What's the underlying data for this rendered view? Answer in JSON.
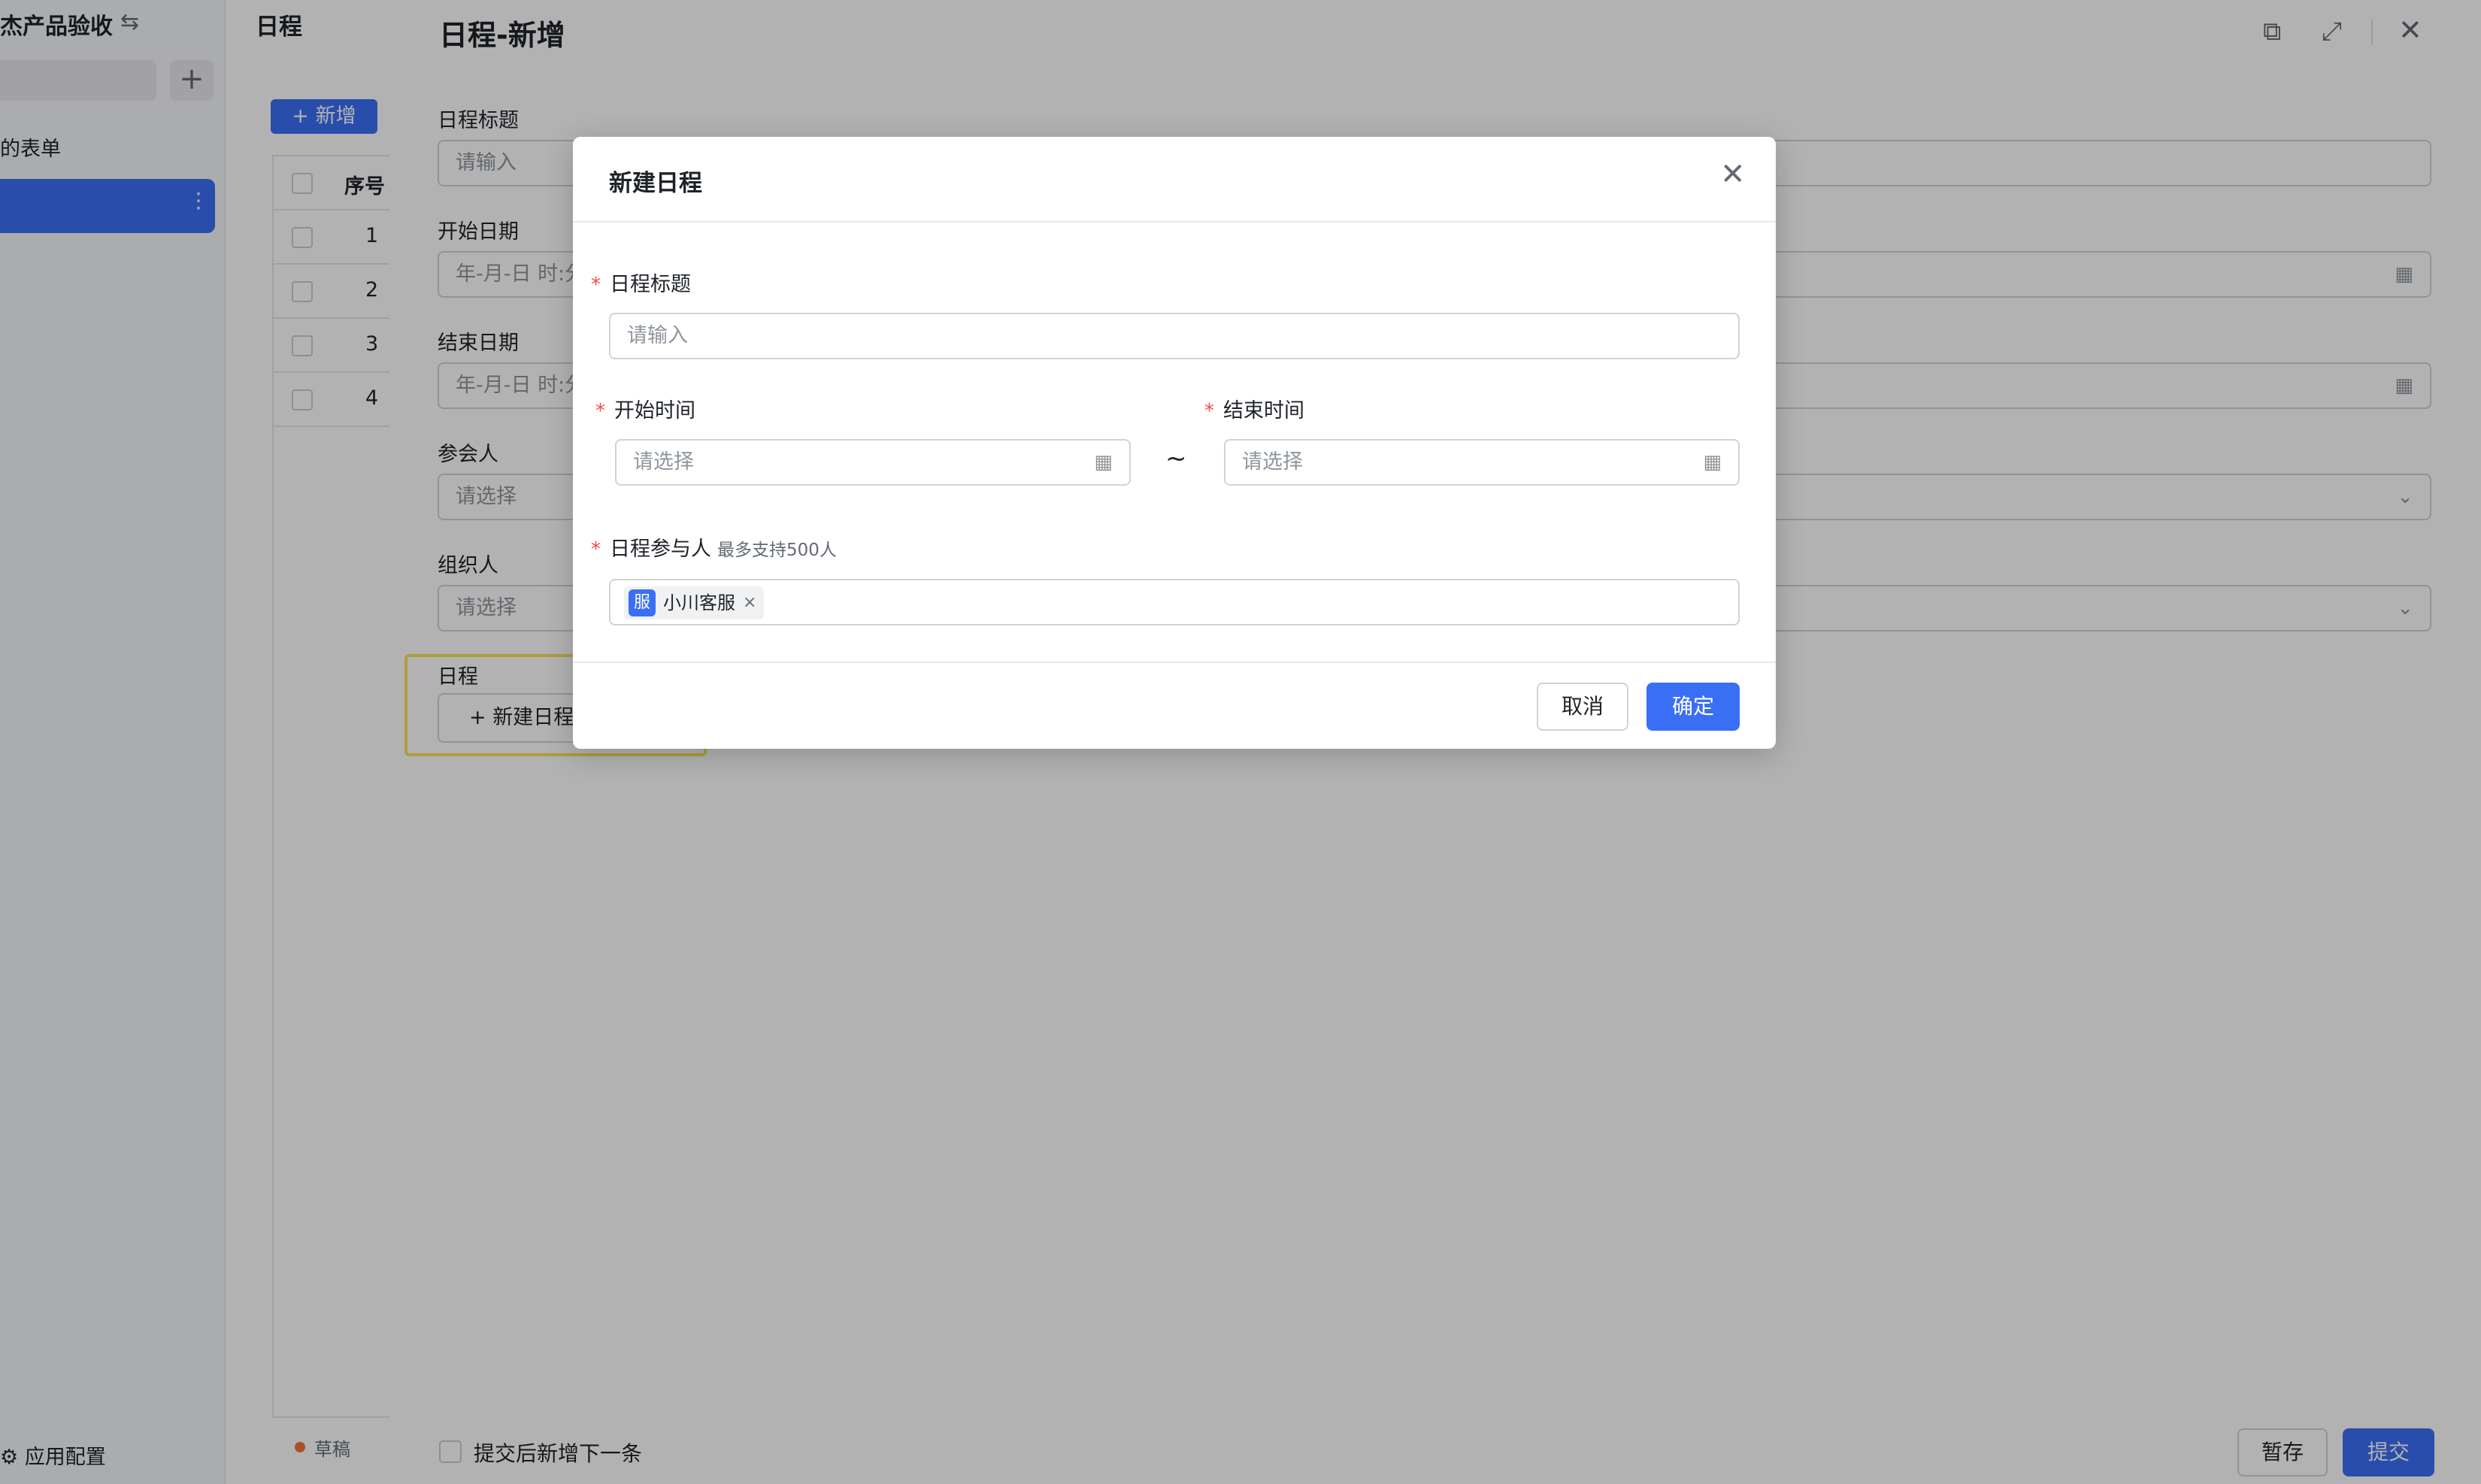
{
  "sidebar": {
    "app_name": "杰产品验收",
    "swap_icon": "⇆",
    "add_icon": "+",
    "form_label": "的表单",
    "more_icon": "⋮",
    "config_icon": "⚙",
    "config_label": "应用配置"
  },
  "list": {
    "title": "日程",
    "add_label": "+ 新增",
    "seq_header": "序号",
    "rows": [
      "1",
      "2",
      "3",
      "4"
    ],
    "draft_label": "草稿"
  },
  "drawer": {
    "title": "日程-新增",
    "open_icon": "⧉",
    "expand_icon": "⤢",
    "close_icon": "✕",
    "fields": {
      "title": {
        "label": "日程标题",
        "placeholder": "请输入"
      },
      "start_date": {
        "label": "开始日期",
        "placeholder": "年-月-日 时:分"
      },
      "end_date": {
        "label": "结束日期",
        "placeholder": "年-月-日 时:分"
      },
      "attendees": {
        "label": "参会人",
        "placeholder": "请选择"
      },
      "organizer": {
        "label": "组织人",
        "placeholder": "请选择"
      },
      "schedule": {
        "label": "日程",
        "button_label": "+ 新建日程"
      }
    },
    "calendar_icon": "▦",
    "chevron_icon": "⌄",
    "footer": {
      "add_next_label": "提交后新增下一条",
      "save_label": "暂存",
      "submit_label": "提交"
    }
  },
  "modal": {
    "title": "新建日程",
    "close_icon": "✕",
    "required_mark": "*",
    "title_field": {
      "label": "日程标题",
      "placeholder": "请输入"
    },
    "start_field": {
      "label": "开始时间",
      "placeholder": "请选择"
    },
    "end_field": {
      "label": "结束时间",
      "placeholder": "请选择"
    },
    "range_separator": "~",
    "participants": {
      "label": "日程参与人",
      "hint": "最多支持500人",
      "tag_avatar": "服",
      "tag_name": "小川客服",
      "tag_remove": "×"
    },
    "cancel_label": "取消",
    "ok_label": "确定"
  },
  "colors": {
    "primary": "#3a6ff5",
    "required": "#f54a45",
    "highlight": "#f7e15a",
    "draft": "#f77234"
  }
}
